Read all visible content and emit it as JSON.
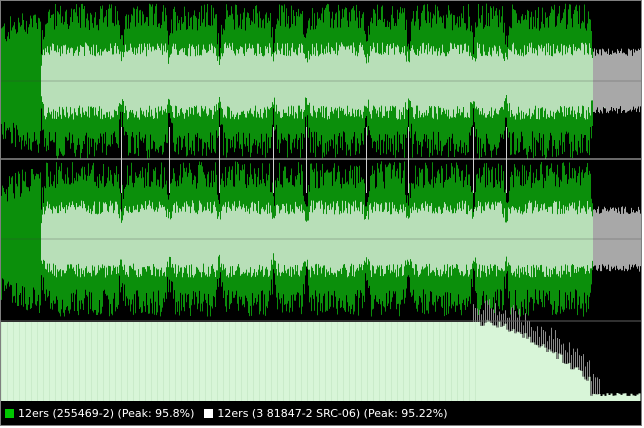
{
  "legend": {
    "series_a": {
      "label": "12ers (255469-2) (Peak: 95.8%)",
      "color": "#00c800"
    },
    "series_b": {
      "label": "12ers (3 81847-2 SRC-06) (Peak: 95.22%)",
      "color": "#ffffff"
    }
  },
  "colors": {
    "background": "#000000",
    "series_a_wave": "#0b8f0b",
    "series_b_wave": "#c8e6c8",
    "series_b_tail": "#a8a8a8",
    "spectrum_fill": "#d8f5d8",
    "divider": "#cfcfcf"
  }
}
